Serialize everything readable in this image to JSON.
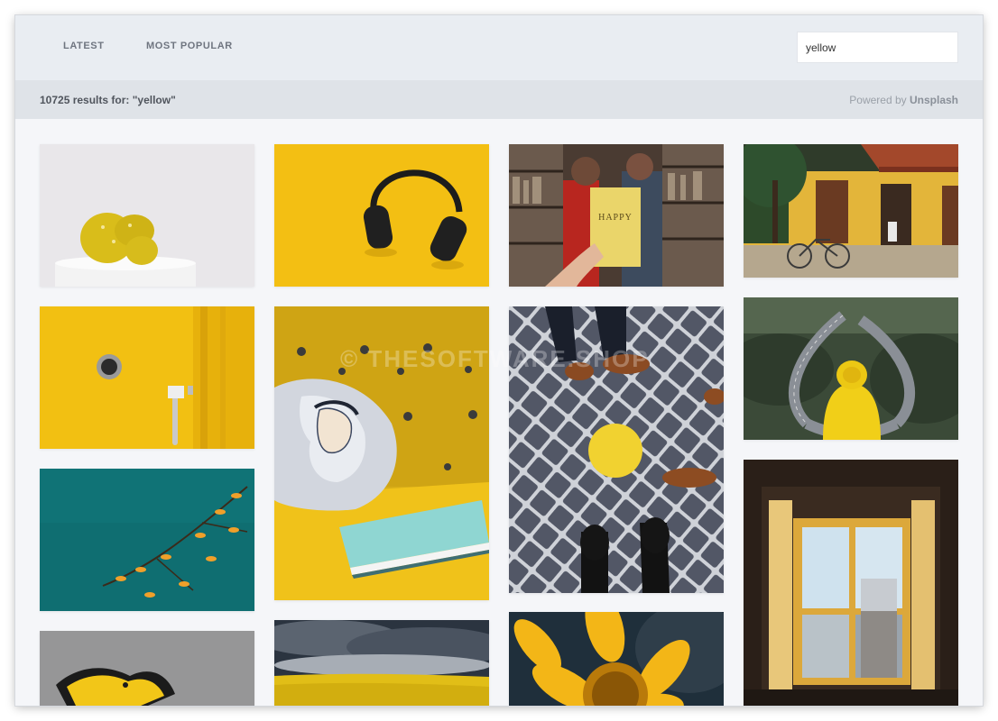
{
  "nav": {
    "tabs": [
      {
        "label": "LATEST"
      },
      {
        "label": "MOST POPULAR"
      }
    ],
    "search": {
      "value": "yellow"
    }
  },
  "results": {
    "summary": "10725 results for: \"yellow\"",
    "powered_prefix": "Powered by ",
    "powered_brand": "Unsplash"
  },
  "watermark": "© THESOFTWARE.SHOP",
  "colors": {
    "nav_bg": "#e9edf2",
    "results_bg": "#dfe3e8",
    "page_bg": "#f5f6f9",
    "accent_yellow": "#f2c318"
  },
  "photos": [
    {
      "name": "photo-cactus"
    },
    {
      "name": "photo-headphones"
    },
    {
      "name": "photo-happy-book"
    },
    {
      "name": "photo-yellow-house-bicycle"
    },
    {
      "name": "photo-yellow-door"
    },
    {
      "name": "photo-pillow-notebook"
    },
    {
      "name": "photo-cobblestone-yellow-circle"
    },
    {
      "name": "photo-yellow-raincoat-road"
    },
    {
      "name": "photo-teal-branch-leaves"
    },
    {
      "name": "photo-window-shutters"
    },
    {
      "name": "photo-graffiti-bird"
    },
    {
      "name": "photo-storm-yellow-field"
    },
    {
      "name": "photo-yellow-flower"
    }
  ]
}
